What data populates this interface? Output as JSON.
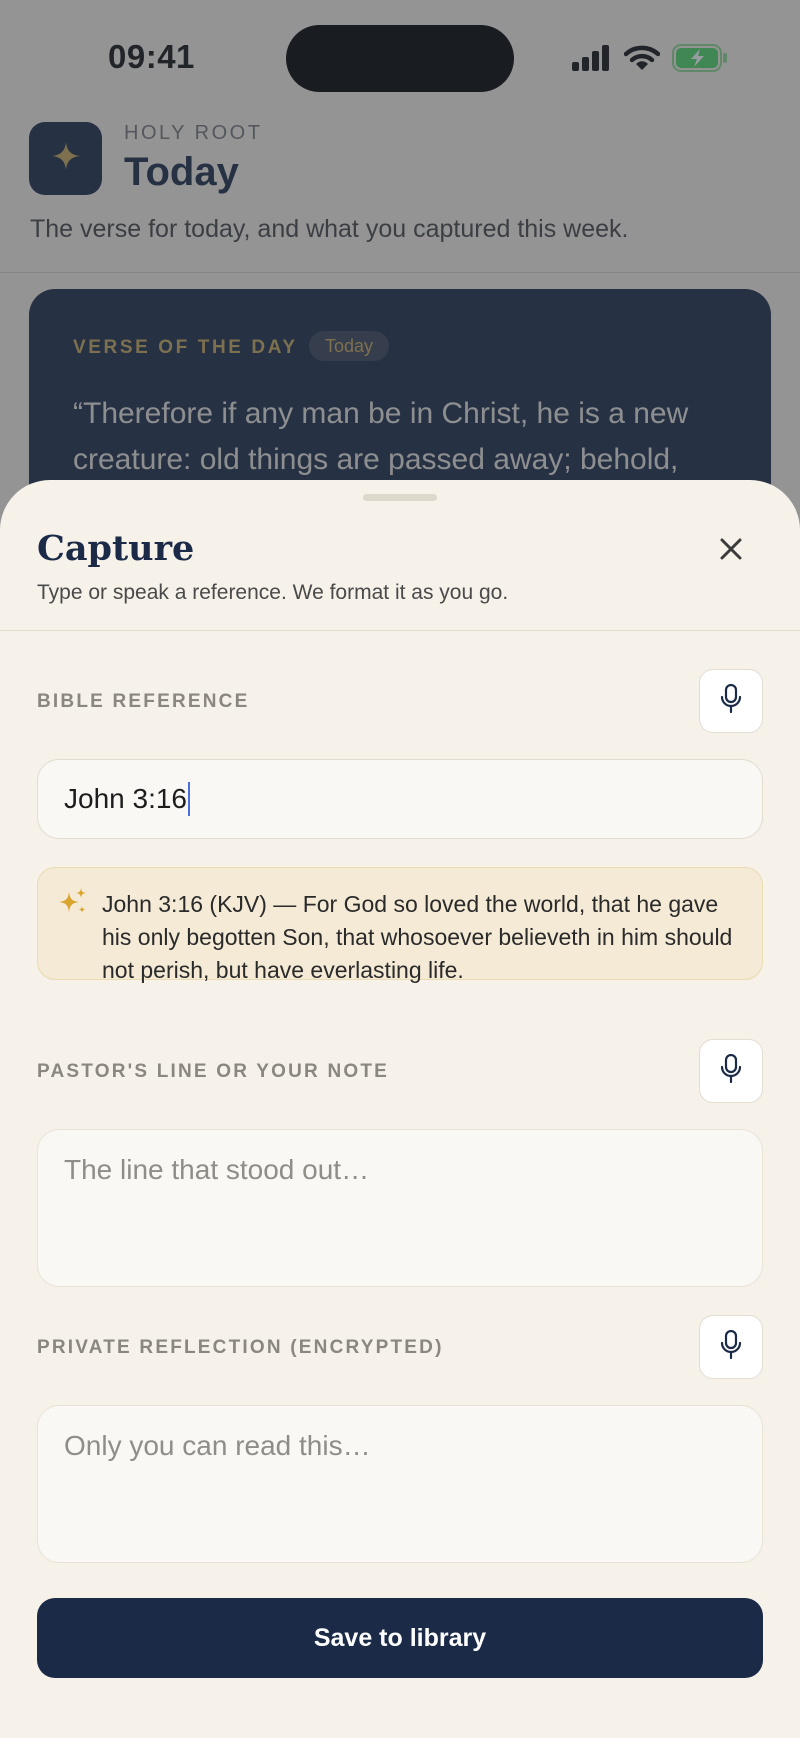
{
  "status_bar": {
    "time": "09:41"
  },
  "app": {
    "kicker": "HOLY ROOT",
    "title": "Today",
    "subtitle": "The verse for today, and what you captured this week."
  },
  "verse_card": {
    "kicker": "VERSE OF THE DAY",
    "pill": "Today",
    "text": "“Therefore if any man be in Christ, he is a new creature: old things are passed away; behold,"
  },
  "sheet": {
    "title": "Capture",
    "subtitle": "Type or speak a reference. We format it as you go.",
    "reference": {
      "label": "BIBLE REFERENCE",
      "value": "John 3:16"
    },
    "suggestion": "John 3:16 (KJV) — For God so loved the world, that he gave his only begotten Son, that whosoever believeth in him should not perish, but have everlasting life.",
    "note": {
      "label": "PASTOR'S LINE OR YOUR NOTE",
      "placeholder": "The line that stood out…"
    },
    "reflection": {
      "label": "PRIVATE REFLECTION (ENCRYPTED)",
      "placeholder": "Only you can read this…"
    },
    "save_label": "Save to library"
  },
  "icons": {
    "logo": "sparkle-icon",
    "close": "close-icon",
    "mic": "microphone-icon",
    "suggestion": "sparkles-icon",
    "signal": "cellular-signal-icon",
    "wifi": "wifi-icon",
    "battery": "battery-charging-icon"
  },
  "colors": {
    "navy": "#1b2a47",
    "gold": "#c8a95a",
    "sheet_bg": "#f6f1e9",
    "suggestion_bg": "#f4ead6",
    "caret": "#4b6fe0",
    "battery": "#4cd964"
  }
}
